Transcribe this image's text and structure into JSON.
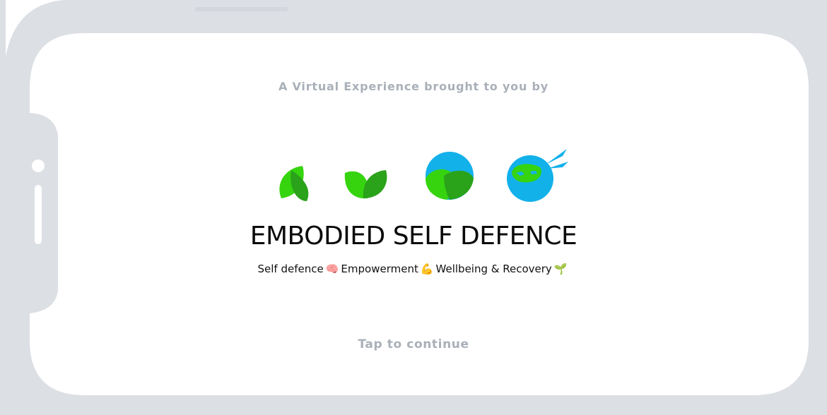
{
  "splash": {
    "eyebrow": "A Virtual Experience brought to you by",
    "title": "EMBODIED SELF DEFENCE",
    "tagline": {
      "part1": "Self defence",
      "emoji1": "🧠",
      "part2": "Empowerment",
      "emoji2": "💪",
      "part3": "Wellbeing & Recovery",
      "emoji3": "🌱"
    },
    "tap_label": "Tap to continue"
  },
  "logo": {
    "icons": [
      "leaf-icon",
      "sprout-icon",
      "leaf-globe-icon",
      "ninja-head-icon"
    ],
    "colors": {
      "leaf_light": "#36d40f",
      "leaf_dark": "#2aa21a",
      "sky_blue": "#12b1ea"
    }
  },
  "theme": {
    "frame_color": "#dcdfe4",
    "muted_text": "#a9b0b9",
    "text": "#0b0b0b"
  }
}
